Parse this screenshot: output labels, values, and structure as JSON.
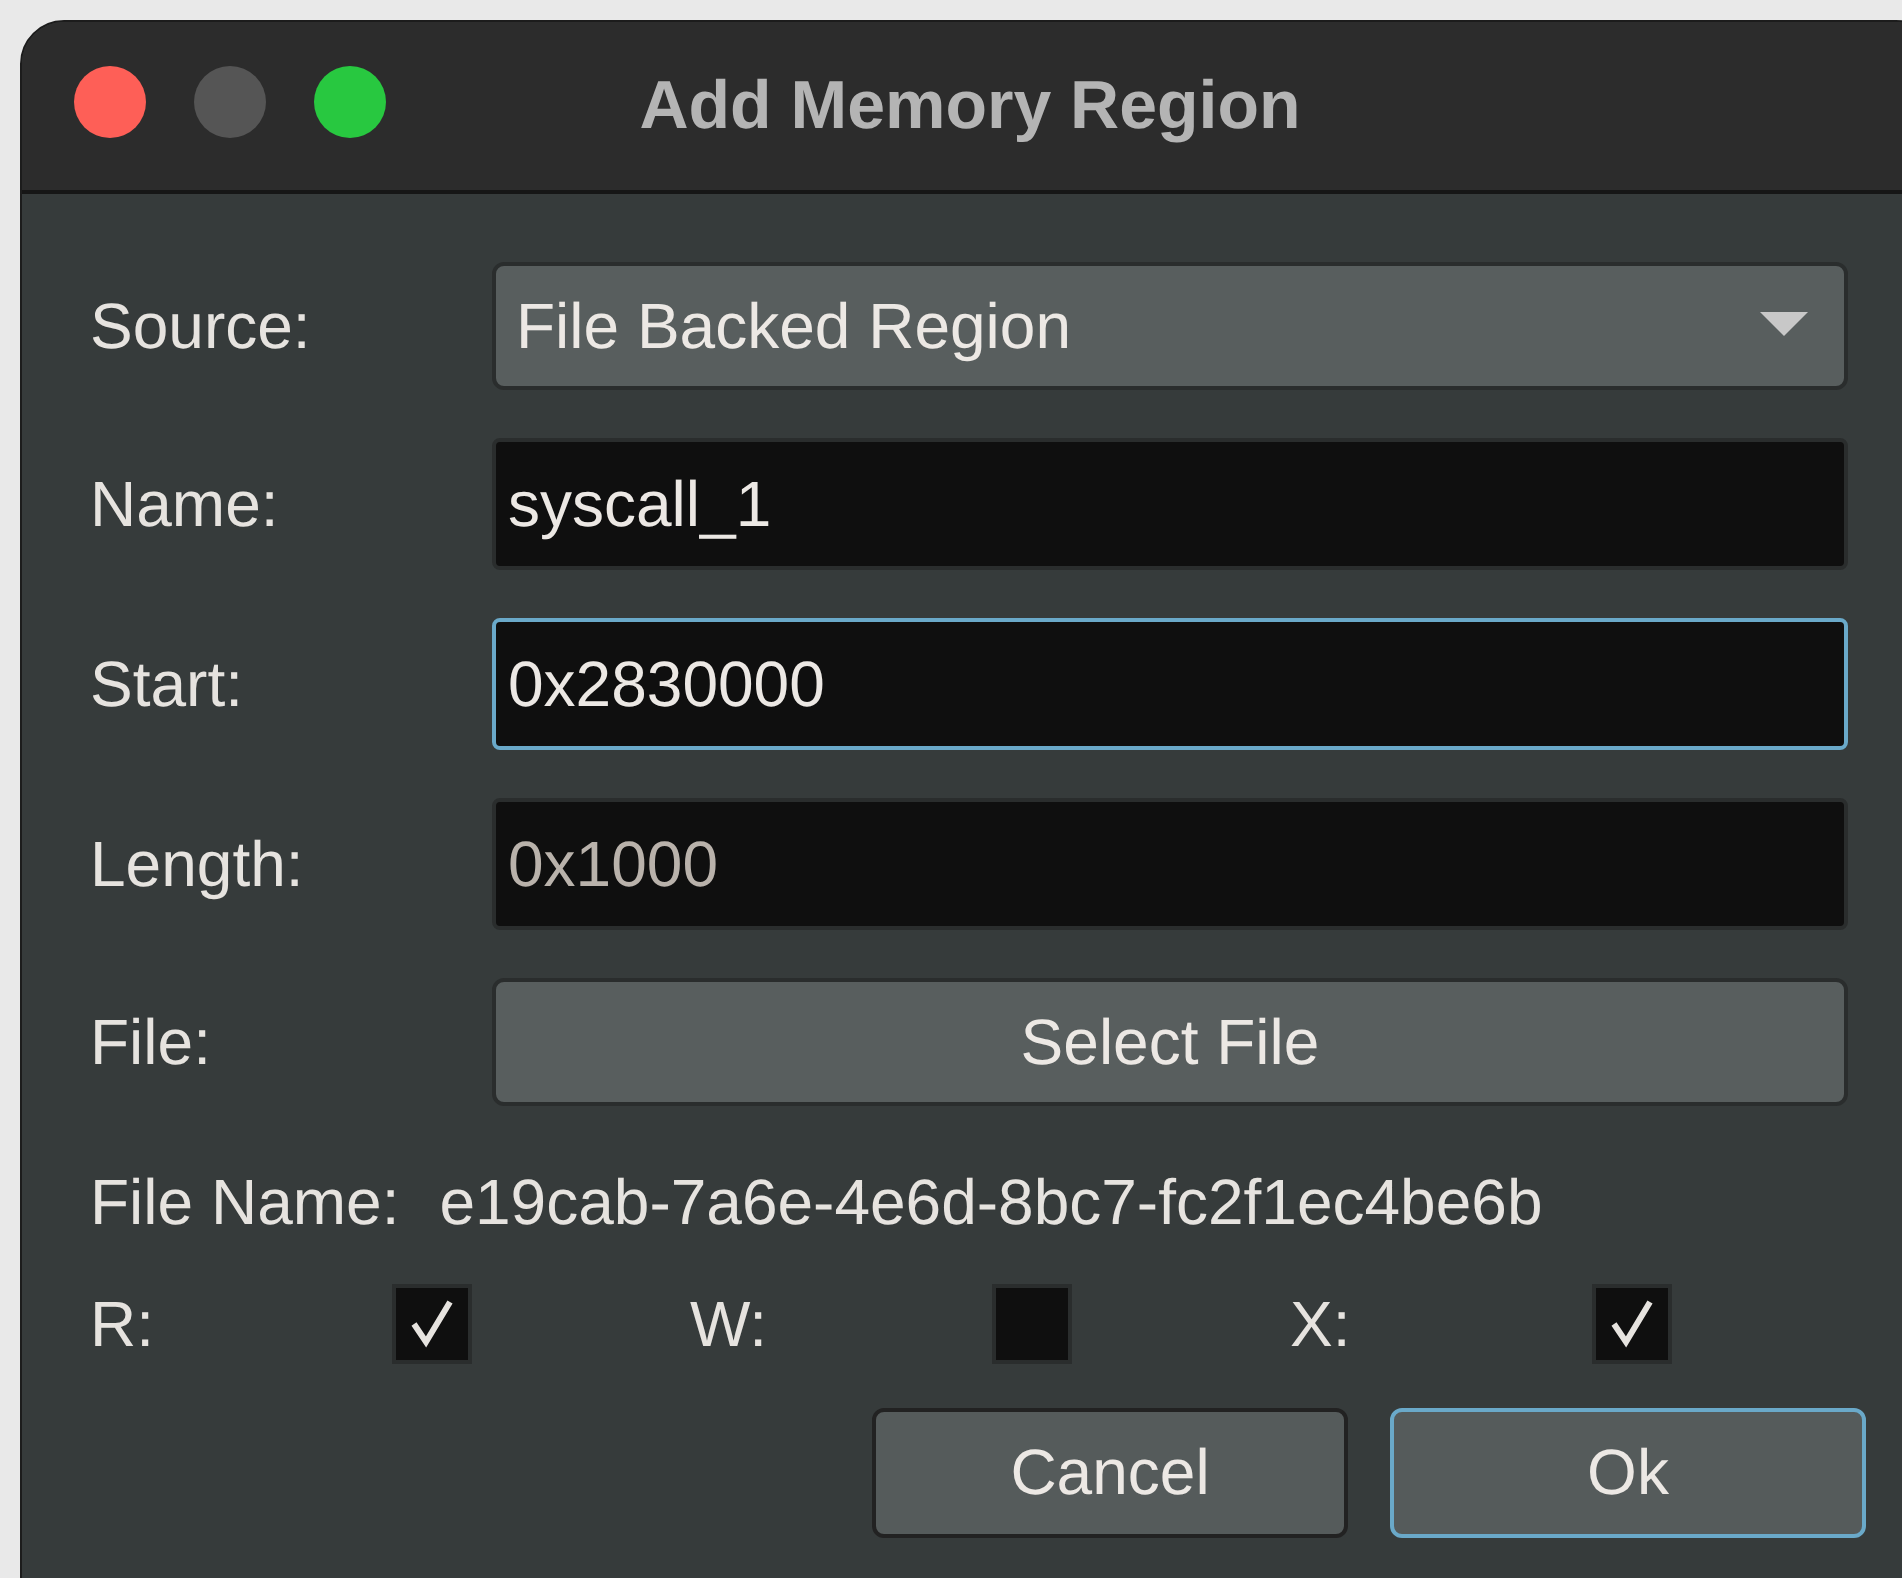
{
  "window": {
    "title": "Add Memory Region"
  },
  "source": {
    "label": "Source:",
    "value": "File Backed Region"
  },
  "fields": [
    {
      "label": "Name:",
      "value": "syscall_1",
      "focused": false
    },
    {
      "label": "Start:",
      "value": "0x2830000",
      "focused": true
    },
    {
      "label": "Length:",
      "placeholder": "0x1000",
      "focused": false
    }
  ],
  "file": {
    "label": "File:",
    "button": "Select File"
  },
  "file_name": {
    "label": "File Name:",
    "value": "e19cab-7a6e-4e6d-8bc7-fc2f1ec4be6b"
  },
  "permissions": [
    {
      "label": "R:",
      "checked": true
    },
    {
      "label": "W:",
      "checked": false
    },
    {
      "label": "X:",
      "checked": true
    }
  ],
  "buttons": [
    {
      "label": "Cancel",
      "default": false
    },
    {
      "label": "Ok",
      "default": true
    }
  ]
}
